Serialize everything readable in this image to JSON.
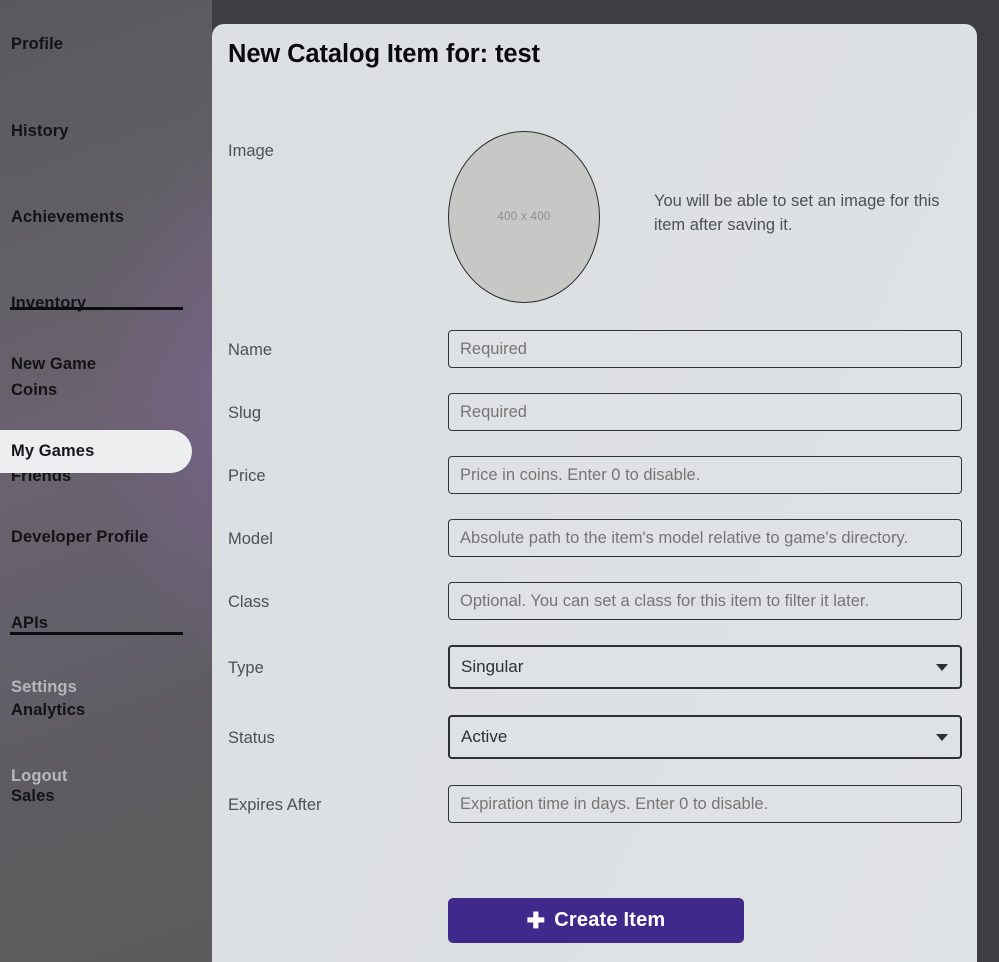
{
  "sidebar": {
    "primary_items": [
      {
        "label": "Profile",
        "name": "profile",
        "state": "normal"
      },
      {
        "label": "History",
        "name": "history",
        "state": "normal"
      },
      {
        "label": "Achievements",
        "name": "achievements",
        "state": "normal"
      },
      {
        "label": "Inventory",
        "name": "inventory",
        "state": "normal"
      },
      {
        "label": "Coins",
        "name": "coins",
        "state": "normal"
      },
      {
        "label": "Friends",
        "name": "friends",
        "state": "normal"
      }
    ],
    "developer_items": [
      {
        "label": "New Game",
        "name": "new-game",
        "state": "normal"
      },
      {
        "label": "My Games",
        "name": "my-games",
        "state": "active"
      },
      {
        "label": "Developer Profile",
        "name": "developer-profile",
        "state": "normal"
      },
      {
        "label": "APIs",
        "name": "apis",
        "state": "normal"
      },
      {
        "label": "Analytics",
        "name": "analytics",
        "state": "normal"
      },
      {
        "label": "Sales",
        "name": "sales",
        "state": "normal"
      }
    ],
    "account_items": [
      {
        "label": "Settings",
        "name": "settings",
        "state": "muted"
      },
      {
        "label": "Logout",
        "name": "logout",
        "state": "muted"
      }
    ]
  },
  "panel": {
    "title": "New Catalog Item for: test",
    "image": {
      "label": "Image",
      "placeholder_text": "400 x 400",
      "note": "You will be able to set an image for this item after saving it."
    },
    "fields": {
      "name": {
        "label": "Name",
        "placeholder": "Required",
        "value": ""
      },
      "slug": {
        "label": "Slug",
        "placeholder": "Required",
        "value": ""
      },
      "price": {
        "label": "Price",
        "placeholder": "Price in coins. Enter 0 to disable.",
        "value": ""
      },
      "model": {
        "label": "Model",
        "placeholder": "Absolute path to the item's model relative to game's directory.",
        "value": ""
      },
      "class": {
        "label": "Class",
        "placeholder": "Optional. You can set a class for this item to filter it later.",
        "value": ""
      },
      "type": {
        "label": "Type",
        "selected": "Singular"
      },
      "status": {
        "label": "Status",
        "selected": "Active"
      },
      "expires_after": {
        "label": "Expires After",
        "placeholder": "Expiration time in days. Enter 0 to disable.",
        "value": ""
      }
    },
    "submit": {
      "label": "Create Item",
      "icon": "plus-icon",
      "color": "#3f2a8c"
    }
  }
}
